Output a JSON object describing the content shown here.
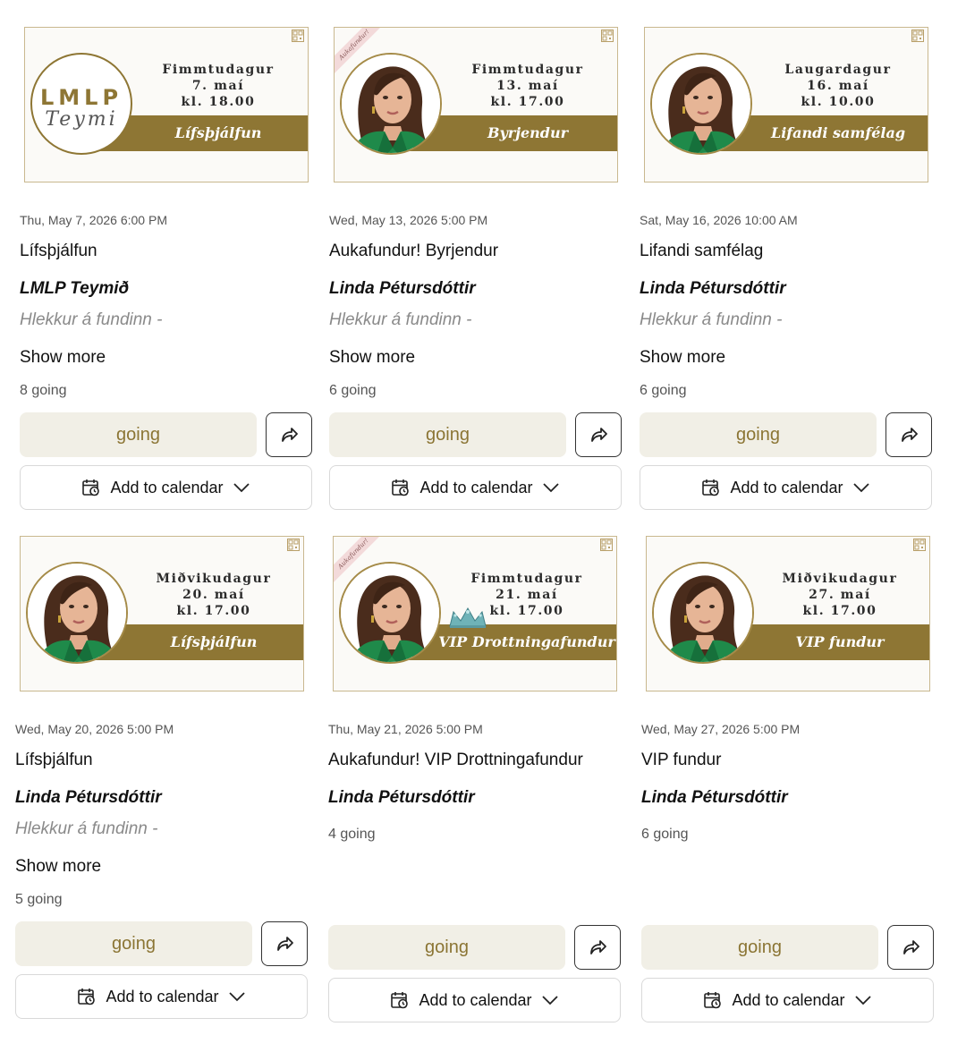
{
  "events": [
    {
      "banner": {
        "weekday": "Fimmtudagur",
        "date": "7. maí",
        "time": "kl. 18.00",
        "label": "Lífsþjálfun",
        "image": "logo",
        "logo_top": "LMLP",
        "logo_bottom": "Teymi",
        "ribbon": null
      },
      "datetime": "Thu, May 7, 2026 6:00 PM",
      "title": "Lífsþjálfun",
      "host": "LMLP Teymið",
      "link": "Hlekkur á fundinn -",
      "show_more": "Show more",
      "going_count": "8 going",
      "going_button": "going",
      "calendar_button": "Add to calendar"
    },
    {
      "banner": {
        "weekday": "Fimmtudagur",
        "date": "13. maí",
        "time": "kl. 17.00",
        "label": "Byrjendur",
        "image": "portrait",
        "ribbon": "Aukafundur!"
      },
      "datetime": "Wed, May 13, 2026 5:00 PM",
      "title": "Aukafundur! Byrjendur",
      "host": "Linda Pétursdóttir",
      "link": "Hlekkur á fundinn -",
      "show_more": "Show more",
      "going_count": "6 going",
      "going_button": "going",
      "calendar_button": "Add to calendar"
    },
    {
      "banner": {
        "weekday": "Laugardagur",
        "date": "16. maí",
        "time": "kl. 10.00",
        "label": "Lifandi samfélag",
        "image": "portrait",
        "ribbon": null
      },
      "datetime": "Sat, May 16, 2026 10:00 AM",
      "title": "Lifandi samfélag",
      "host": "Linda Pétursdóttir",
      "link": "Hlekkur á fundinn -",
      "show_more": "Show more",
      "going_count": "6 going",
      "going_button": "going",
      "calendar_button": "Add to calendar"
    },
    {
      "banner": {
        "weekday": "Miðvikudagur",
        "date": "20. maí",
        "time": "kl. 17.00",
        "label": "Lífsþjálfun",
        "image": "portrait",
        "ribbon": null
      },
      "datetime": "Wed, May 20, 2026 5:00 PM",
      "title": "Lífsþjálfun",
      "host": "Linda Pétursdóttir",
      "link": "Hlekkur á fundinn -",
      "show_more": "Show more",
      "going_count": "5 going",
      "going_button": "going",
      "calendar_button": "Add to calendar"
    },
    {
      "banner": {
        "weekday": "Fimmtudagur",
        "date": "21. maí",
        "time": "kl. 17.00",
        "label": "VIP Drottningafundur",
        "image": "portrait",
        "ribbon": "Aukafundur!",
        "crown": true
      },
      "datetime": "Thu, May 21, 2026 5:00 PM",
      "title": "Aukafundur! VIP Drottningafundur",
      "host": "Linda Pétursdóttir",
      "link": null,
      "show_more": null,
      "going_count": "4 going",
      "going_button": "going",
      "calendar_button": "Add to calendar"
    },
    {
      "banner": {
        "weekday": "Miðvikudagur",
        "date": "27. maí",
        "time": "kl. 17.00",
        "label": "VIP fundur",
        "image": "portrait",
        "ribbon": null
      },
      "datetime": "Wed, May 27, 2026 5:00 PM",
      "title": "VIP fundur",
      "host": "Linda Pétursdóttir",
      "link": null,
      "show_more": null,
      "going_count": "6 going",
      "going_button": "going",
      "calendar_button": "Add to calendar"
    }
  ],
  "icons": {
    "share": "share-arrow-icon",
    "calendar": "calendar-clock-icon",
    "chevron": "chevron-down-icon",
    "banner_corner": "qr-code-icon",
    "crown": "crown-icon"
  },
  "colors": {
    "accent_gold": "#8e7634",
    "going_bg": "#f1efe6",
    "going_text": "#8b7534",
    "portrait_ring": "#a58b48"
  }
}
